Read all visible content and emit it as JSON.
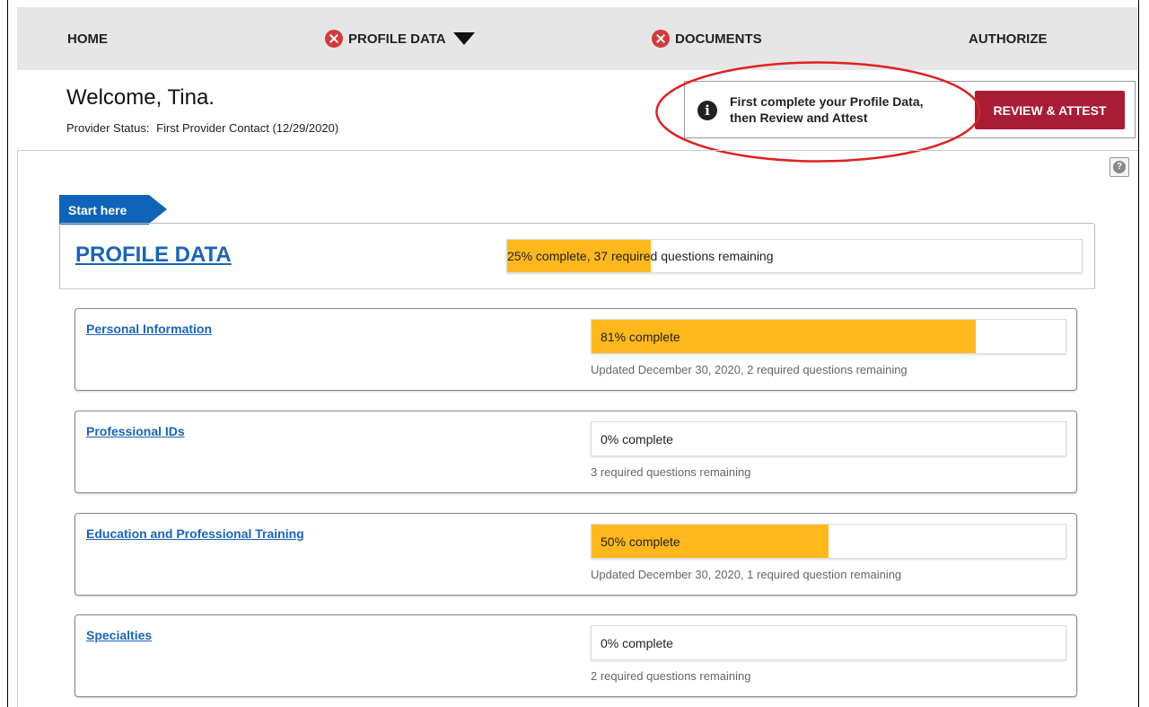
{
  "nav": {
    "home": "HOME",
    "profile_data": "PROFILE DATA",
    "documents": "DOCUMENTS",
    "authorize": "AUTHORIZE"
  },
  "header": {
    "welcome": "Welcome, Tina.",
    "status_label": "Provider Status:",
    "status_value": "First Provider Contact (12/29/2020)"
  },
  "alert": {
    "message_line1": "First complete your Profile Data,",
    "message_line2": "then Review and Attest",
    "button_label": "REVIEW & ATTEST"
  },
  "start_here": "Start here",
  "profile": {
    "title": "PROFILE DATA",
    "progress_text": "25% complete, 37 required questions remaining",
    "progress_percent": 25
  },
  "sections": [
    {
      "title": "Personal Information",
      "progress_text": "81% complete",
      "progress_percent": 81,
      "subtext": "Updated December 30, 2020, 2 required questions remaining"
    },
    {
      "title": "Professional IDs",
      "progress_text": "0% complete",
      "progress_percent": 0,
      "subtext": "3 required questions remaining"
    },
    {
      "title": "Education and Professional Training",
      "progress_text": "50% complete",
      "progress_percent": 50,
      "subtext": "Updated December 30, 2020, 1 required question remaining"
    },
    {
      "title": "Specialties",
      "progress_text": "0% complete",
      "progress_percent": 0,
      "subtext": "2 required questions remaining"
    }
  ],
  "colors": {
    "progress_fill": "#ffb81c",
    "link": "#1a64b8",
    "review_button": "#a81d35",
    "error_icon": "#d33a3a",
    "start_flag": "#0f64b9",
    "annotation": "#e02020"
  },
  "icons": {
    "error": "x-circle-icon",
    "dropdown": "caret-down-icon",
    "info": "info-circle-icon",
    "help": "question-circle-icon"
  }
}
